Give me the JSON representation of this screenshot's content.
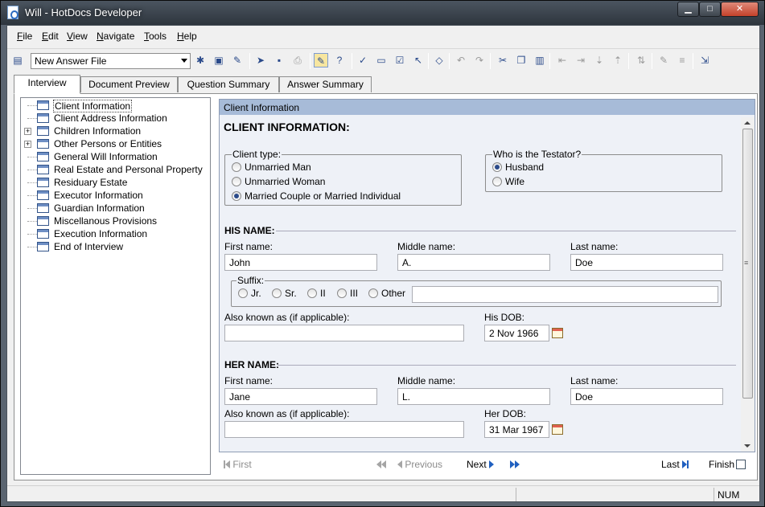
{
  "window": {
    "title": "Will - HotDocs Developer",
    "controls": {
      "minimize": "▁",
      "maximize": "□",
      "close": "✕"
    }
  },
  "menu": [
    {
      "text": "File",
      "ul": "F",
      "rest": "ile"
    },
    {
      "text": "Edit",
      "ul": "E",
      "rest": "dit"
    },
    {
      "text": "View",
      "ul": "V",
      "rest": "iew"
    },
    {
      "text": "Navigate",
      "ul": "N",
      "rest": "avigate"
    },
    {
      "text": "Tools",
      "ul": "T",
      "rest": "ools"
    },
    {
      "text": "Help",
      "ul": "H",
      "rest": "elp"
    }
  ],
  "toolbar": {
    "answer_file": "New Answer File",
    "icons": [
      "document-icon",
      "new-answer-icon",
      "open-answer-icon",
      "edit-answer-icon",
      "next-step-icon",
      "save-icon",
      "print-icon",
      "answer-summary-icon",
      "help-icon",
      "spell-check-icon",
      "insert-field-icon",
      "check-icon",
      "mark-icon",
      "eraser-icon",
      "undo-icon",
      "redo-icon",
      "cut-icon",
      "copy-icon",
      "paste-icon",
      "indent-left-icon",
      "indent-right-icon",
      "move-down-icon",
      "move-up-icon",
      "sort-icon",
      "edit-icon",
      "properties-icon",
      "import-icon"
    ]
  },
  "tabs": [
    "Interview",
    "Document Preview",
    "Question Summary",
    "Answer Summary"
  ],
  "tree": [
    {
      "label": "Client Information",
      "expandable": false,
      "selected": true
    },
    {
      "label": "Client Address Information",
      "expandable": false
    },
    {
      "label": "Children Information",
      "expandable": true,
      "expander": "+"
    },
    {
      "label": "Other Persons or Entities",
      "expandable": true,
      "expander": "+"
    },
    {
      "label": "General Will Information",
      "expandable": false
    },
    {
      "label": "Real Estate and Personal Property",
      "expandable": false
    },
    {
      "label": "Residuary Estate",
      "expandable": false
    },
    {
      "label": "Executor Information",
      "expandable": false
    },
    {
      "label": "Guardian Information",
      "expandable": false
    },
    {
      "label": "Miscellanous Provisions",
      "expandable": false
    },
    {
      "label": "Execution Information",
      "expandable": false
    },
    {
      "label": "End of Interview",
      "expandable": false
    }
  ],
  "form": {
    "header": "Client Information",
    "heading": "CLIENT INFORMATION:",
    "client_type": {
      "legend": "Client type:",
      "options": [
        "Unmarried Man",
        "Unmarried Woman",
        "Married Couple or Married Individual"
      ],
      "selected": 2
    },
    "testator": {
      "legend": "Who is the Testator?",
      "options": [
        "Husband",
        "Wife"
      ],
      "selected": 0
    },
    "his": {
      "heading": "HIS NAME:",
      "first_label": "First name:",
      "first": "John",
      "middle_label": "Middle name:",
      "middle": "A.",
      "last_label": "Last name:",
      "last": "Doe",
      "suffix_legend": "Suffix:",
      "suffix_options": [
        "Jr.",
        "Sr.",
        "II",
        "III",
        "Other"
      ],
      "suffix_other": "",
      "aka_label": "Also known as (if applicable):",
      "aka": "",
      "dob_label": "His DOB:",
      "dob": "2 Nov 1966"
    },
    "her": {
      "heading": "HER NAME:",
      "first_label": "First name:",
      "first": "Jane",
      "middle_label": "Middle name:",
      "middle": "L.",
      "last_label": "Last name:",
      "last": "Doe",
      "aka_label": "Also known as (if applicable):",
      "aka": "",
      "dob_label": "Her DOB:",
      "dob": "31 Mar 1967"
    }
  },
  "nav": {
    "first": "First",
    "previous": "Previous",
    "next": "Next",
    "last": "Last",
    "finish": "Finish"
  },
  "status": {
    "num": "NUM"
  }
}
